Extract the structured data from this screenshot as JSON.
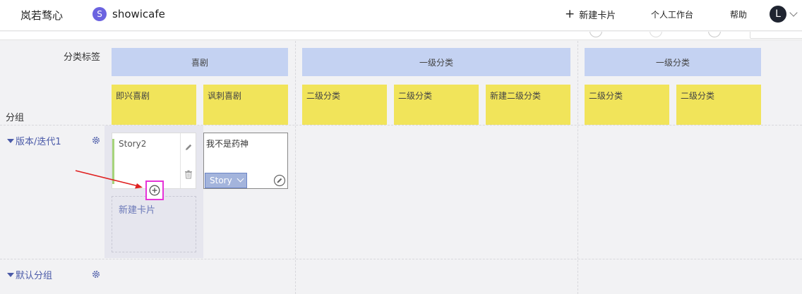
{
  "topbar": {
    "brand": "岚若骛心",
    "project_initial": "S",
    "project_name": "showicafe",
    "new_card": "新建卡片",
    "workspace": "个人工作台",
    "help": "帮助",
    "user_initial": "L"
  },
  "board": {
    "category_label": "分类标签",
    "group_label": "分组",
    "level1": [
      {
        "label": "喜剧"
      },
      {
        "label": "一级分类"
      },
      {
        "label": "一级分类"
      }
    ],
    "level2": [
      {
        "label": "即兴喜剧"
      },
      {
        "label": "讽刺喜剧"
      },
      {
        "label": "二级分类"
      },
      {
        "label": "二级分类"
      },
      {
        "label": "新建二级分类"
      },
      {
        "label": "二级分类"
      },
      {
        "label": "二级分类"
      }
    ],
    "groups": [
      {
        "label": "版本/迭代1"
      },
      {
        "label": "默认分组"
      }
    ],
    "cards": [
      {
        "title": "Story2"
      },
      {
        "title": "我不是药神",
        "type": "Story"
      }
    ],
    "new_card_placeholder": "新建卡片"
  },
  "colors": {
    "level1_bg": "#c4d2f2",
    "level2_bg": "#f1e45a",
    "accent": "#4a5aa8",
    "highlight_box": "#e633d8",
    "annotation_arrow": "#e02020"
  }
}
